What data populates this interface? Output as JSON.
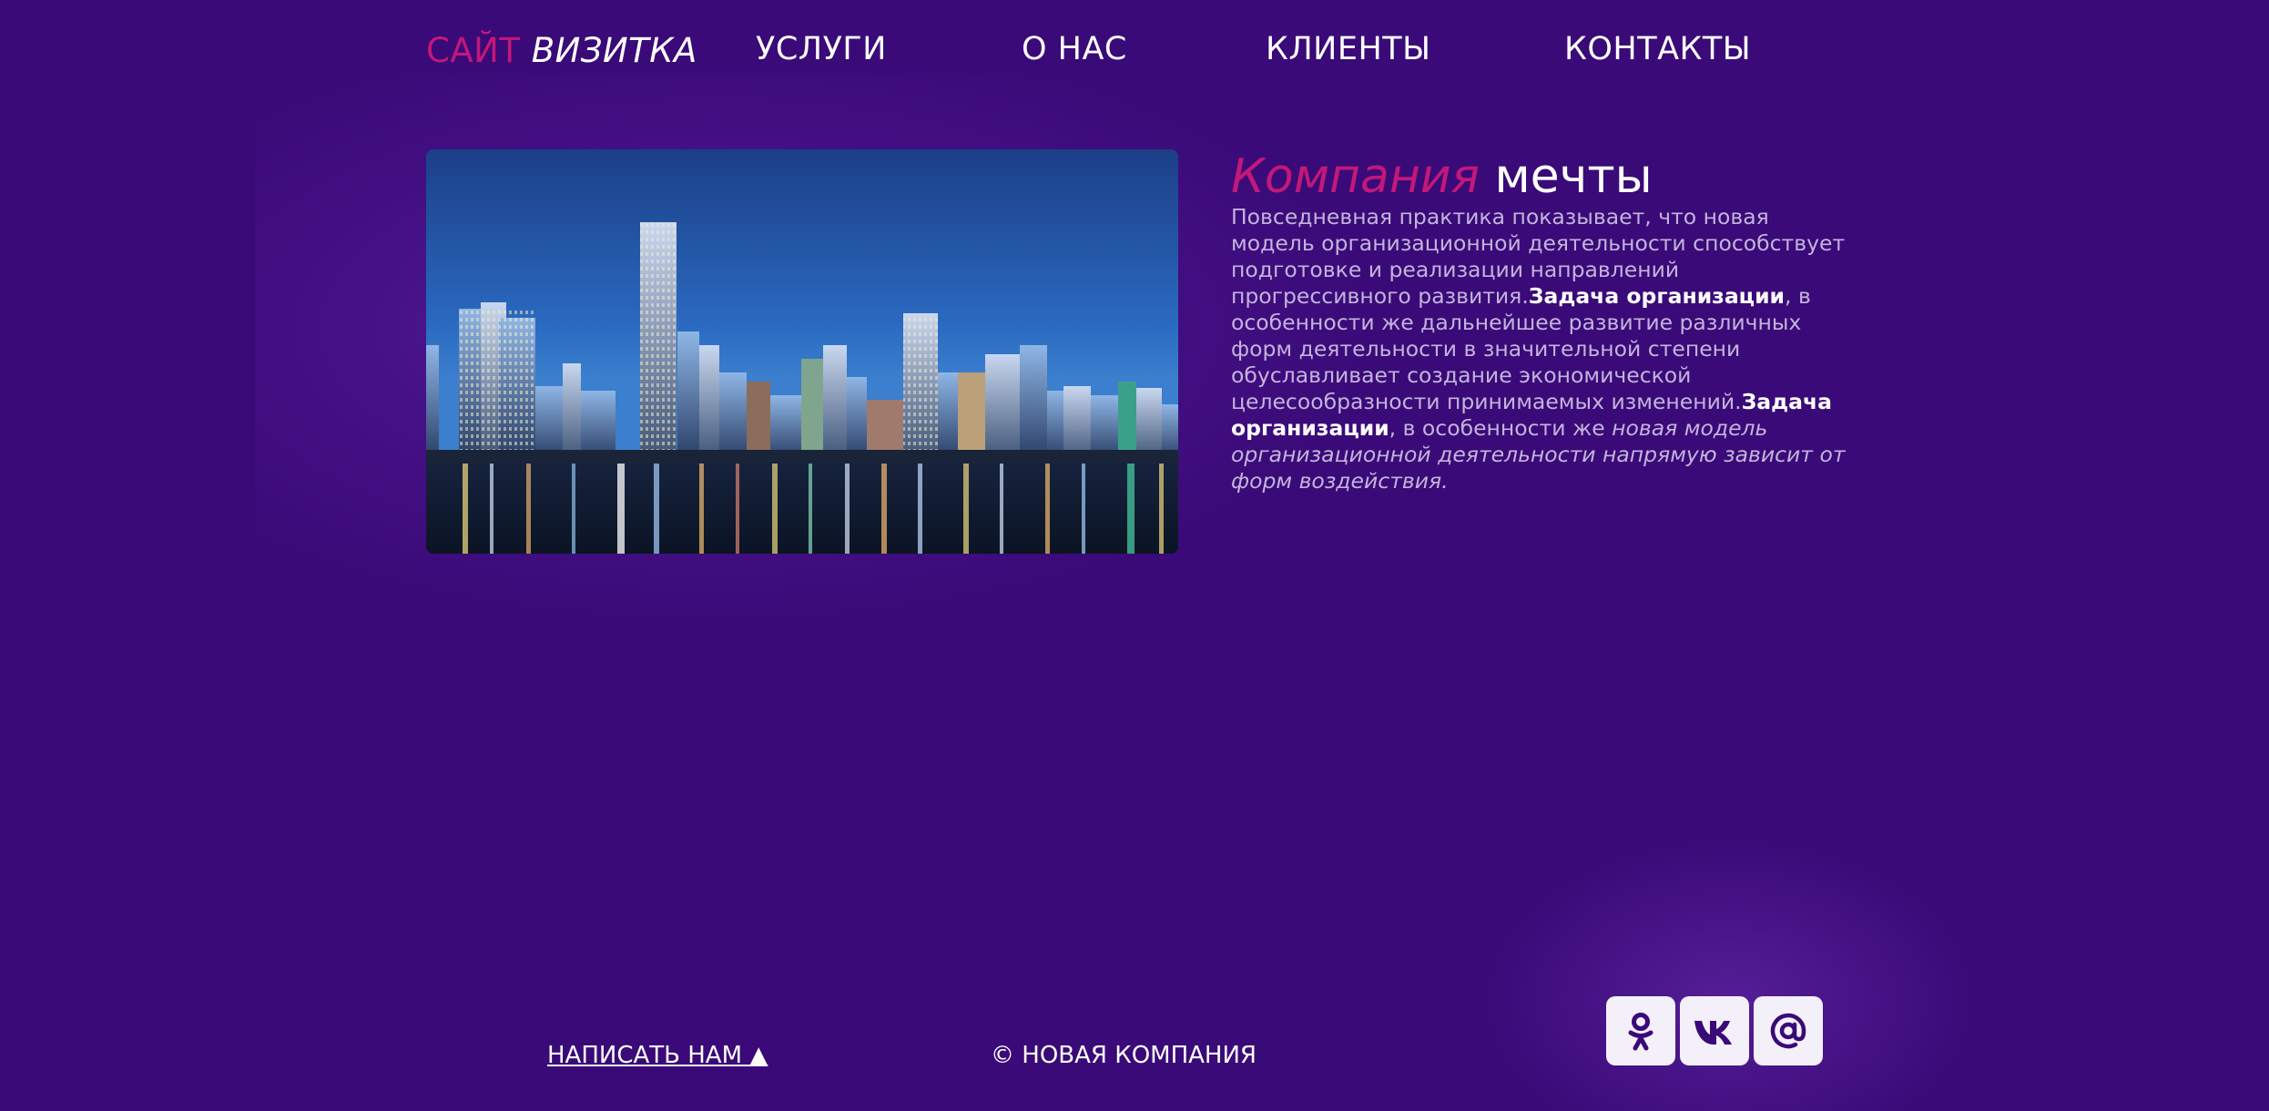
{
  "nav": {
    "logo_part1": "САЙТ",
    "logo_part2": "ВИЗИТКА",
    "items": [
      {
        "label": "УСЛУГИ"
      },
      {
        "label": "О НАС"
      },
      {
        "label": "КЛИЕНТЫ"
      },
      {
        "label": "КОНТАКТЫ"
      }
    ]
  },
  "hero": {
    "image": "city-skyline-night-photo"
  },
  "about": {
    "title_part1": "Компания",
    "title_part2": "мечты",
    "text_1": "Повседневная практика показывает, что новая модель организационной деятельности способствует подготовке и реализации направлений прогрессивного развития.",
    "bold_1": "Задача организации",
    "text_2": ", в особенности же дальнейшее развитие различных форм деятельности в значительной степени обуславливает создание экономической целесообразности принимаемых изменений.",
    "bold_2": "Задача организации",
    "text_3": ", в особенности же ",
    "italic_1": "новая модель организационной деятельности напрямую зависит от форм воздействия."
  },
  "footer": {
    "write_us": "НАПИСАТЬ НАМ ▲",
    "copyright": "© НОВАЯ КОМПАНИЯ",
    "social": [
      {
        "icon": "odnoklassniki-icon"
      },
      {
        "icon": "vk-icon"
      },
      {
        "icon": "mail-at-icon"
      }
    ]
  },
  "colors": {
    "background": "#3a0a78",
    "accent_pink": "#c2187a",
    "text_muted": "#c3b3dc",
    "social_icon": "#3a0a78"
  }
}
